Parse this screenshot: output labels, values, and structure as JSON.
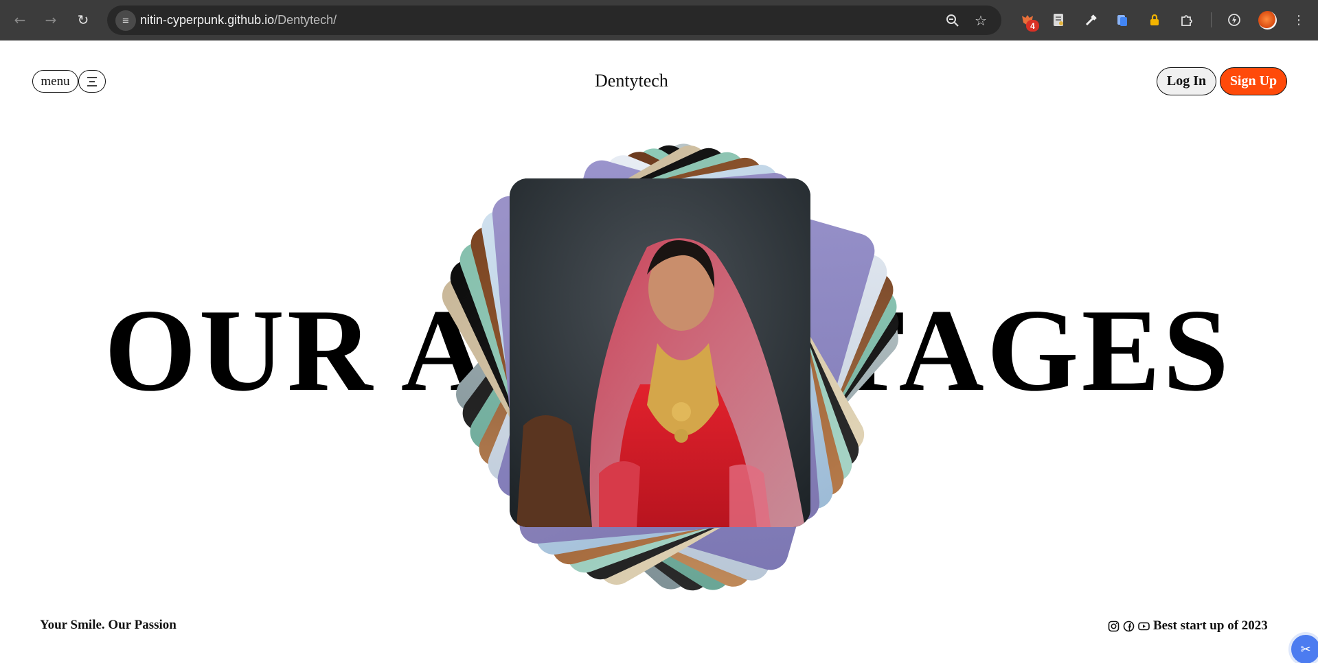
{
  "browser": {
    "url_host": "nitin-cyperpunk.github.io",
    "url_path": "/Dentytech/",
    "extension_badge_count": "4",
    "icons": [
      "back-icon",
      "forward-icon",
      "reload-icon",
      "site-info-icon",
      "zoom-icon",
      "bookmark-star-icon",
      "extensions-puzzle-icon",
      "profile-avatar",
      "kebab-menu-icon"
    ]
  },
  "header": {
    "menu_label": "menu",
    "brand": "Dentytech",
    "login_label": "Log In",
    "signup_label": "Sign Up"
  },
  "hero": {
    "headline": "OUR ADVANTAGES"
  },
  "footer": {
    "tagline": "Your Smile. Our Passion",
    "award": "Best start up of 2023",
    "social_icons": [
      "instagram-icon",
      "facebook-icon",
      "youtube-icon"
    ]
  },
  "colors": {
    "accent": "#ff4a0a",
    "chrome_bg": "#3c3c3c",
    "omnibox_bg": "#282828"
  }
}
